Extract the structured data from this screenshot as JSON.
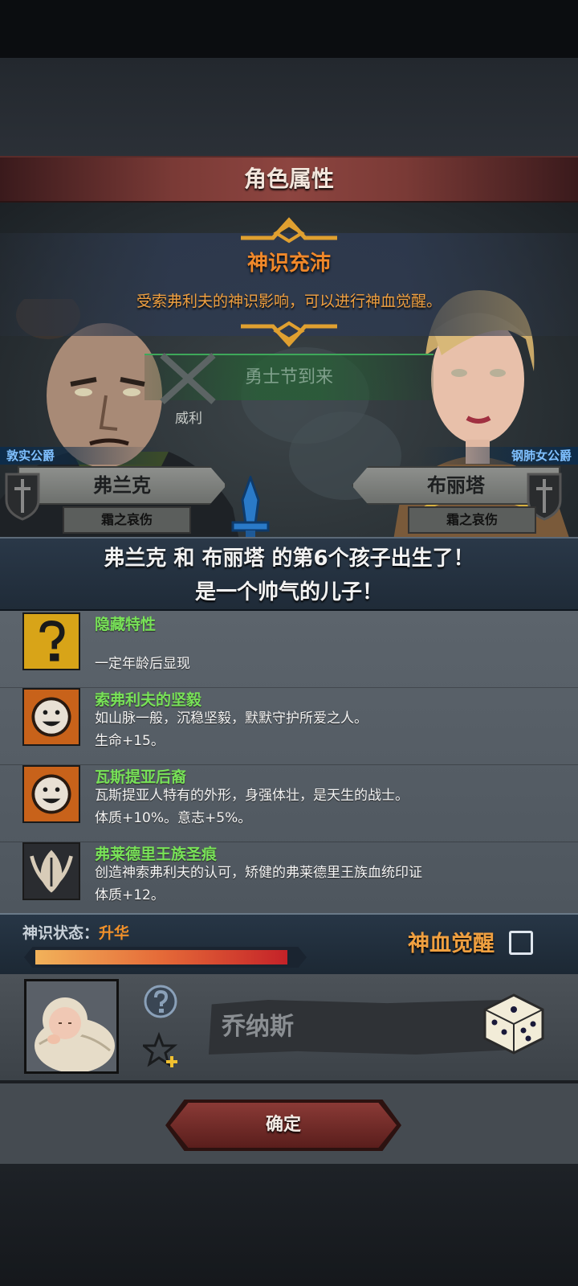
{
  "header": {
    "title": "角色属性"
  },
  "event": {
    "title": "神识充沛",
    "description": "受索弗利夫的神识影响，可以进行神血觉醒。"
  },
  "scene": {
    "holiday": "勇士节到来",
    "location": "威利"
  },
  "father": {
    "title": "敦实公爵",
    "name": "弗兰克",
    "trait": "霜之哀伤"
  },
  "mother": {
    "title": "钢肺女公爵",
    "name": "布丽塔",
    "trait": "霜之哀伤"
  },
  "birth": {
    "line1": "弗兰克 和 布丽塔 的第6个孩子出生了！",
    "line2": "是一个帅气的儿子！"
  },
  "traits": [
    {
      "icon": "question-mark-icon",
      "name": "隐藏特性",
      "desc1": "",
      "desc2": "一定年龄后显现"
    },
    {
      "icon": "smiley-icon",
      "name": "索弗利夫的坚毅",
      "desc1": "如山脉一般，沉稳坚毅，默默守护所爱之人。",
      "desc2": "生命+15。"
    },
    {
      "icon": "smiley-icon",
      "name": "瓦斯提亚后裔",
      "desc1": "瓦斯提亚人特有的外形，身强体壮，是天生的战士。",
      "desc2": "体质+10%。意志+5%。"
    },
    {
      "icon": "royal-crest-icon",
      "name": "弗莱德里王族圣痕",
      "desc1": "创造神索弗利夫的认可，矫健的弗莱德里王族血统印证",
      "desc2": "体质+12。"
    }
  ],
  "divine": {
    "label": "神识状态：",
    "value": "升华",
    "progress": 0.97,
    "awaken_label": "神血觉醒"
  },
  "child": {
    "name": "乔纳斯"
  },
  "footer": {
    "confirm": "确定"
  },
  "colors": {
    "accent_orange": "#f0882a",
    "trait_green": "#78e258",
    "title_blue": "#7fc0ff",
    "header_red": "#8d4540"
  }
}
